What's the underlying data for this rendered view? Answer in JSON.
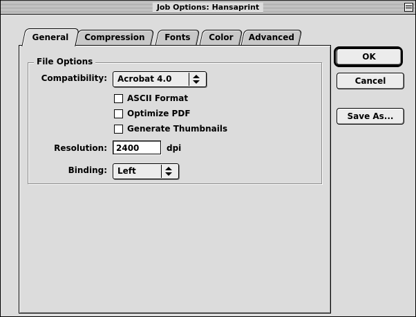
{
  "window": {
    "title": "Job Options: Hansaprint"
  },
  "tabs": [
    {
      "label": "General",
      "active": true
    },
    {
      "label": "Compression",
      "active": false
    },
    {
      "label": "Fonts",
      "active": false
    },
    {
      "label": "Color",
      "active": false
    },
    {
      "label": "Advanced",
      "active": false
    }
  ],
  "file_options": {
    "title": "File Options",
    "compatibility_label": "Compatibility:",
    "compatibility_value": "Acrobat 4.0",
    "checkboxes": [
      {
        "label": "ASCII Format",
        "checked": false
      },
      {
        "label": "Optimize PDF",
        "checked": false
      },
      {
        "label": "Generate Thumbnails",
        "checked": false
      }
    ],
    "resolution_label": "Resolution:",
    "resolution_value": "2400",
    "resolution_unit": "dpi",
    "binding_label": "Binding:",
    "binding_value": "Left"
  },
  "buttons": {
    "ok": "OK",
    "cancel": "Cancel",
    "save_as": "Save As..."
  },
  "icons": {
    "collapse": "collapse-box-icon",
    "popup_arrows": "up-down-arrows-icon"
  },
  "colors": {
    "window_bg": "#dcdcdc",
    "field_bg": "#ffffff",
    "border": "#000000"
  }
}
